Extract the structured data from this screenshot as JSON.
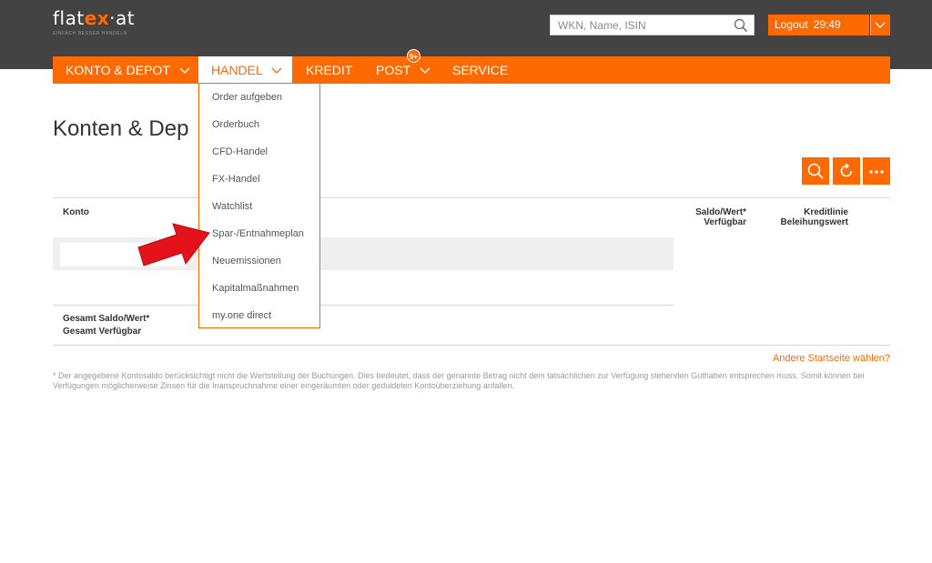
{
  "brand": {
    "logo_prefix": "flat",
    "logo_ex": "ex",
    "logo_suffix": "·at",
    "tagline": "EINFACH BESSER HANDELN"
  },
  "search": {
    "placeholder": "WKN, Name, ISIN"
  },
  "session": {
    "logout_label": "Logout",
    "timer": "29:49"
  },
  "nav": {
    "items": [
      {
        "label": "KONTO & DEPOT"
      },
      {
        "label": "HANDEL"
      },
      {
        "label": "KREDIT"
      },
      {
        "label": "POST"
      },
      {
        "label": "SERVICE"
      }
    ],
    "post_badge": "9+"
  },
  "dropdown": {
    "items": [
      {
        "label": "Order aufgeben"
      },
      {
        "label": "Orderbuch"
      },
      {
        "label": "CFD-Handel"
      },
      {
        "label": "FX-Handel"
      },
      {
        "label": "Watchlist"
      },
      {
        "label": "Spar-/Entnahmeplan"
      },
      {
        "label": "Neuemissionen"
      },
      {
        "label": "Kapitalmaßnahmen"
      },
      {
        "label": "my.one direct"
      }
    ]
  },
  "page": {
    "title": "Konten & Dep"
  },
  "table": {
    "col_konto": "Konto",
    "col_saldo_1": "Saldo/Wert*",
    "col_saldo_2": "Verfügbar",
    "col_kredit_1": "Kreditlinie",
    "col_kredit_2": "Beleihungswert",
    "total_1": "Gesamt Saldo/Wert*",
    "total_2": "Gesamt Verfügbar"
  },
  "links": {
    "other_start": "Andere Startseite wählen?"
  },
  "footnote": "* Der angegebene Kontosaldo berücksichtigt nicht die Wertstellung der Buchungen. Dies bedeutet, dass der genannte Betrag nicht dem tatsächlichen zur Verfügung stehenden Guthaben entsprechen muss. Somit können bei Verfügungen möglicherweise Zinsen für die Inanspruchnahme einer eingeräumten oder geduldeten Kontoüberziehung anfallen.",
  "colors": {
    "accent": "#ff6a00",
    "header_bg": "#434343",
    "annotation_arrow": "#e3121b"
  }
}
